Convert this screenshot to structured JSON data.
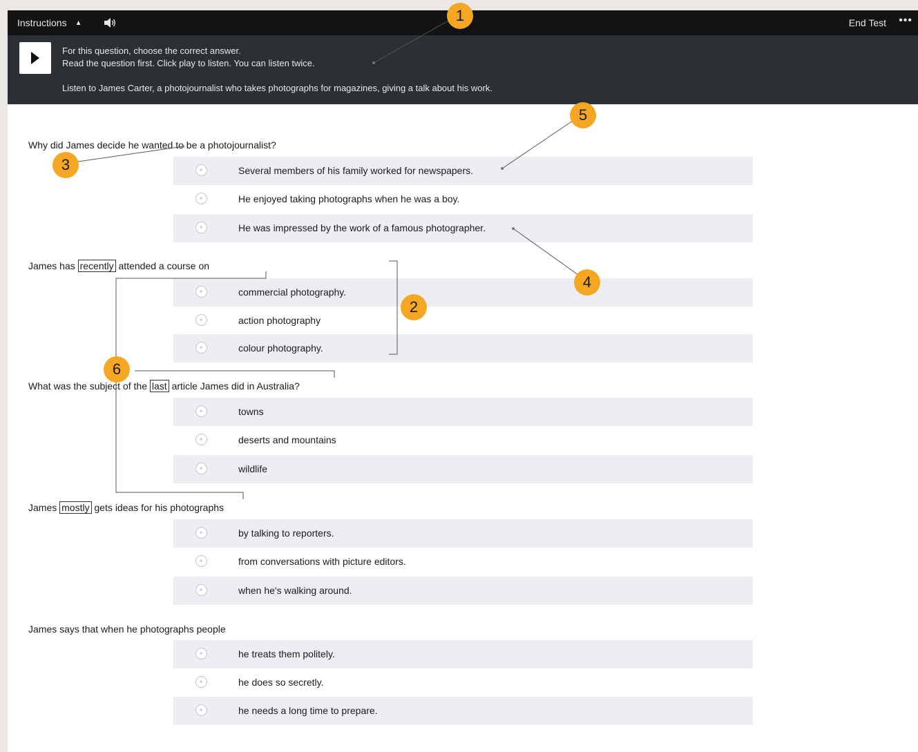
{
  "topbar": {
    "instructions_label": "Instructions",
    "instructions_caret": "▲",
    "end_test_label": "End Test",
    "more_label": "•••"
  },
  "instructions": {
    "line1": "For this question, choose the correct answer.",
    "line2": "Read the question first. Click play to listen. You can listen twice.",
    "context": "Listen to James Carter, a photojournalist who takes photographs for magazines, giving a talk about his work."
  },
  "questions": [
    {
      "text": "Why did James decide he wanted to be a photojournalist?",
      "options": [
        "Several members of his family worked for newspapers.",
        "He enjoyed taking photographs when he was a boy.",
        "He was impressed by the work of a famous photographer."
      ]
    },
    {
      "text_before": "James has",
      "highlight": "recently",
      "text_after": "attended a course on",
      "options": [
        "commercial photography.",
        "action photography",
        "colour photography."
      ]
    },
    {
      "text_before": "What was the subject of the",
      "highlight": "last",
      "text_after": "article James did in Australia?",
      "options": [
        "towns",
        "deserts and mountains",
        "wildlife"
      ]
    },
    {
      "text_before": "James",
      "highlight": "mostly",
      "text_after": "gets ideas for his photographs",
      "options": [
        "by talking to reporters.",
        "from conversations with picture editors.",
        "when he's walking around."
      ]
    },
    {
      "text": "James says that when he photographs people",
      "options": [
        "he treats them politely.",
        "he does so secretly.",
        "he needs a long time to prepare."
      ]
    }
  ],
  "callouts": [
    "1",
    "2",
    "3",
    "4",
    "5",
    "6"
  ],
  "colors": {
    "topbar": "#111315",
    "panel": "#2c2f33",
    "badge": "#f5a623",
    "option_shade": "#eceef1"
  },
  "icons": {
    "audio": "speaker-icon",
    "play": "play-icon",
    "more": "more-icon"
  }
}
